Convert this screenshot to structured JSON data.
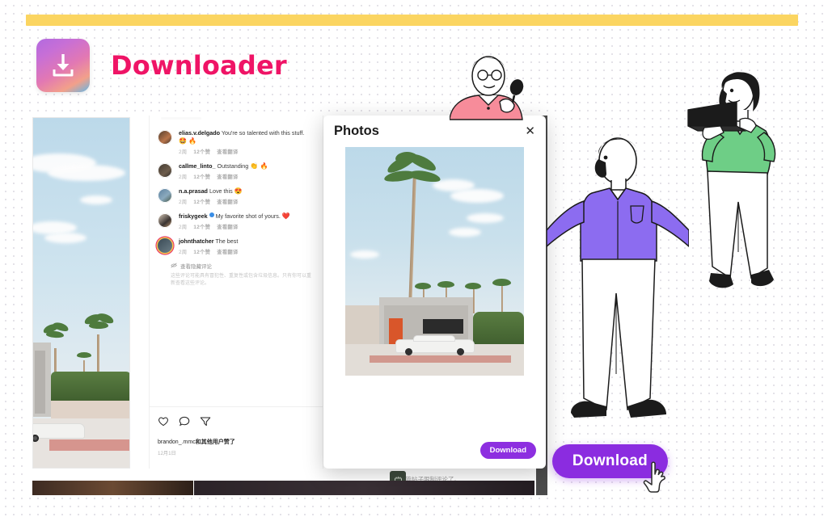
{
  "brand": {
    "title": "Downloader",
    "logo_icon": "download-box-icon",
    "logo_gradient_from": "#b26ae0",
    "logo_gradient_to": "#62b6e8",
    "title_color": "#ef1466",
    "top_bar_color": "#fbd561"
  },
  "comments_panel": {
    "comments": [
      {
        "user": "elias.v.delgado",
        "text": "You're so talented with this stuff.",
        "emoji": "🤩 🔥",
        "verified": false,
        "time": "2周",
        "likes": "12个赞",
        "translate": "查看翻译"
      },
      {
        "user": "callme_linto_",
        "text": "Outstanding",
        "emoji": "👏 🔥",
        "verified": false,
        "time": "2周",
        "likes": "12个赞",
        "translate": "查看翻译"
      },
      {
        "user": "n.a.prasad",
        "text": "Love this",
        "emoji": "😍",
        "verified": false,
        "time": "2周",
        "likes": "12个赞",
        "translate": "查看翻译"
      },
      {
        "user": "friskygeek",
        "text": "My favorite shot of yours.",
        "emoji": "❤️",
        "verified": true,
        "time": "2周",
        "likes": "12个赞",
        "translate": "查看翻译"
      },
      {
        "user": "johnthatcher",
        "text": "The best",
        "emoji": "",
        "verified": false,
        "time": "2周",
        "likes": "12个赞",
        "translate": "查看翻译"
      }
    ],
    "hidden_notice_title": "查看隐藏评论",
    "hidden_notice_desc": "这些评论可能具有冒犯性、重复性或包含垃圾信息。只有你可以重新查看这些评论。",
    "actions": {
      "like_icon": "heart-icon",
      "comment_icon": "comment-bubble-icon",
      "share_icon": "share-icon"
    },
    "likes_text": "brandon_.mmc",
    "likes_suffix": "和其他用户赞了",
    "date": "12月1日",
    "restricted_text": "这篇帖子限制评论了。",
    "restricted_icon": "restricted-box-icon"
  },
  "photos_modal": {
    "title": "Photos",
    "close_icon": "close-icon",
    "download_label": "Download",
    "download_color": "#8d2fe0",
    "photo_alt": "palm-tree-building-car-photo"
  },
  "cta": {
    "download_label": "Download",
    "download_color": "#8b2ce0",
    "cursor_icon": "hand-cursor-icon"
  },
  "illustrations": {
    "microphone_person": "person-with-microphone-illustration",
    "standing_man": "standing-man-purple-shirt-illustration",
    "laptop_woman": "woman-holding-laptop-illustration"
  }
}
